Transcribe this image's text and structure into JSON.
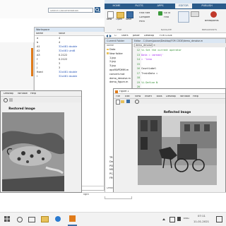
{
  "search": {
    "placeholder": "Search Documentation"
  },
  "matlab_tabs": [
    "HOME",
    "PLOTS",
    "APPS",
    "EDITOR",
    "PUBLISH"
  ],
  "toolstrip": {
    "buttons": [
      "New",
      "Open",
      "Save"
    ],
    "nav_items": [
      "Find Files",
      "Compare",
      "Print",
      "Go To",
      "Find"
    ],
    "breakpoints": "Breakpoints"
  },
  "toolstrip_groups": [
    "FILE",
    "NAVIGATE",
    "BREAKPOINTS"
  ],
  "address_bar": {
    "path": [
      "C:",
      "Users",
      "pavan",
      "Desktop",
      "FOR CODE"
    ]
  },
  "current_folder": {
    "title": "Current Folder",
    "col_name": "Name",
    "files": [
      "Data",
      "New folder",
      "1.jpg",
      "2.jpg",
      "3.jpg",
      "apxMAPDMM.m",
      "convert.mat",
      "demo_denoise.m",
      "demo_figure.m"
    ],
    "more_files": [
      "TRB",
      "Def",
      "PSN",
      "MSE",
      "PCA",
      "FRG"
    ],
    "status": "Details"
  },
  "workspace": {
    "title": "Workspace",
    "col_name": "Name",
    "col_value": "Value",
    "rows": [
      {
        "name": "a",
        "value": "4"
      },
      {
        "name": "b",
        "value": "4"
      },
      {
        "name": "A1",
        "value": "32x481 double"
      },
      {
        "name": "A2",
        "value": "32x481 uint8"
      },
      {
        "name": "A3",
        "value": "0.2122"
      },
      {
        "name": "f",
        "value": "0.2122"
      },
      {
        "name": "J",
        "value": "3"
      },
      {
        "name": "J",
        "value": "3"
      },
      {
        "name": "fixed",
        "value": "32x481 double"
      },
      {
        "name": "I",
        "value": "32x481 double"
      }
    ],
    "footer_left": "noisy_img",
    "footer_right": "32x481 uint8"
  },
  "editor": {
    "title_text": "Editor - C:\\Users\\pavan\\Desktop\\FOR CODE\\demo_denoise.m",
    "tab": "demo_denoise.m",
    "lines": [
      {
        "n": "12",
        "code": "  %% Set the current operator"
      },
      {
        "n": "13",
        "code": "  Data = imread('"
      },
      {
        "n": "14",
        "code": "    = 'lena"
      },
      {
        "n": "15",
        "code": ""
      },
      {
        "n": "16",
        "code": "  CountLabel"
      },
      {
        "n": "17",
        "code": "  TrainData = "
      },
      {
        "n": "18",
        "code": ""
      },
      {
        "n": "19",
        "code": "  %% Define N"
      },
      {
        "n": "20",
        "code": ""
      }
    ]
  },
  "figure_left": {
    "menu": [
      "Desktop",
      "Window",
      "Help"
    ],
    "image_title": "Restored Image"
  },
  "figure_right": {
    "window_title": "Figure 1",
    "menu": [
      "File",
      "Edit",
      "View",
      "Insert",
      "Tools",
      "Desktop",
      "Window",
      "Help"
    ],
    "image_title": "Reflected Image"
  },
  "command_window": {
    "status": "ngth"
  },
  "taskbar": {
    "language": "ENG",
    "time": "07:11",
    "date": "11-01-2021"
  },
  "colors": {
    "matlab_blue": "#2a5b8a",
    "panel_header": "#dbe7f4",
    "accent_orange": "#e07b1a",
    "line_number_green": "#2c8a2c"
  }
}
